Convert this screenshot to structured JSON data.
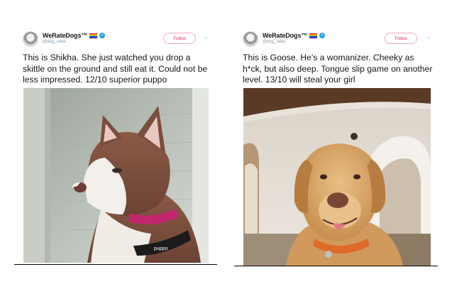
{
  "tweets": [
    {
      "account": {
        "name": "WeRateDogs™",
        "handle": "@dog_rates"
      },
      "follow_label": "Follow",
      "text": "This is Shikha. She just watched you drop a skittle on the ground and still eat it. Could not be less impressed. 12/10 superior puppo",
      "collar_tag": "puppo"
    },
    {
      "account": {
        "name": "WeRateDogs™",
        "handle": "@dog_rates"
      },
      "follow_label": "Follow",
      "text": "This is Goose. He's a womanizer. Cheeky as h*ck, but also deep. Tongue slip game on another level. 13/10 will steal your girl"
    }
  ],
  "colors": {
    "follow_accent": "#e0245e",
    "verified": "#1da1f2",
    "text": "#14171a",
    "muted": "#8899a6"
  },
  "icons": [
    "avatar",
    "rainbow-flag-icon",
    "verified-badge-icon",
    "chevron-down-icon"
  ]
}
